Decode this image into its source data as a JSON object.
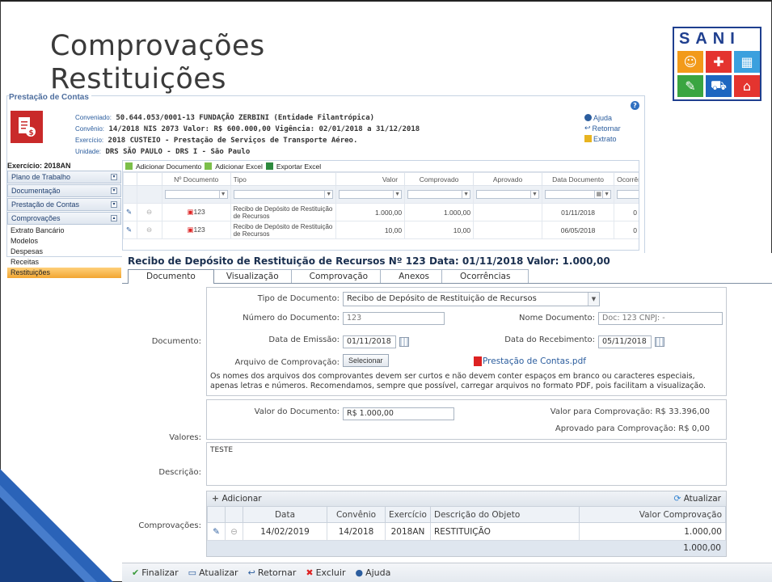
{
  "slide": {
    "title_line1": "Comprovações",
    "title_line2": "Restituições",
    "logo_text": "SANI"
  },
  "app": {
    "caption": "Prestação de Contas",
    "convenio_labels": {
      "conveniado": "Conveniado:",
      "convenio": "Convênio:",
      "exercicio": "Exercício:",
      "unidade": "Unidade:"
    },
    "conveniado": "50.644.053/0001-13 FUNDAÇÃO ZERBINI (Entidade Filantrópica)",
    "convenio": "14/2018 NIS 2073 Valor: R$ 600.000,00 Vigência: 02/01/2018 a 31/12/2018",
    "exercicio": "2018 CUSTEIO - Prestação de Serviços de Transporte Aéreo.",
    "unidade": "DRS SÃO PAULO - DRS I - São Paulo",
    "links": {
      "ajuda": "Ajuda",
      "retornar": "Retornar",
      "extrato": "Extrato"
    }
  },
  "sidebar": {
    "exercicio": "Exercício: 2018AN",
    "groups": [
      "Plano de Trabalho",
      "Documentação",
      "Prestação de Contas",
      "Comprovações"
    ],
    "items": [
      "Extrato Bancário",
      "Modelos",
      "Despesas",
      "Receitas",
      "Restituições"
    ]
  },
  "grid": {
    "toolbar": {
      "add_doc": "Adicionar Documento",
      "add_excel": "Adicionar Excel",
      "export_excel": "Exportar Excel"
    },
    "columns": [
      "Nº Documento",
      "Tipo",
      "Valor",
      "Comprovado",
      "Aprovado",
      "Data Documento",
      "Ocorrênci"
    ],
    "rows": [
      {
        "num": "123",
        "tipo": "Recibo de Depósito de Restituição de Recursos",
        "valor": "1.000,00",
        "comprovado": "1.000,00",
        "aprovado": "",
        "data": "01/11/2018",
        "ocorr": "0"
      },
      {
        "num": "123",
        "tipo": "Recibo de Depósito de Restituição de Recursos",
        "valor": "10,00",
        "comprovado": "10,00",
        "aprovado": "",
        "data": "06/05/2018",
        "ocorr": "0"
      }
    ]
  },
  "panel": {
    "title": "Recibo de Depósito de Restituição de Recursos Nº 123 Data: 01/11/2018 Valor: 1.000,00",
    "tabs": [
      "Documento",
      "Visualização",
      "Comprovação",
      "Anexos",
      "Ocorrências"
    ],
    "section_labels": {
      "documento": "Documento:",
      "valores": "Valores:",
      "descricao": "Descrição:",
      "comprovacoes": "Comprovações:"
    },
    "form": {
      "tipo_label": "Tipo de Documento:",
      "tipo_value": "Recibo de Depósito de Restituição de Recursos",
      "numero_label": "Número do Documento:",
      "numero_value": "123",
      "nome_label": "Nome Documento:",
      "nome_value": "Doc: 123 CNPJ: -",
      "emissao_label": "Data de Emissão:",
      "emissao_value": "01/11/2018",
      "recebimento_label": "Data do Recebimento:",
      "recebimento_value": "05/11/2018",
      "arquivo_label": "Arquivo de Comprovação:",
      "selecionar": "Selecionar",
      "pdf_name": "Prestação de Contas.pdf",
      "note": "Os nomes dos arquivos dos comprovantes devem ser curtos e não devem conter espaços em branco ou caracteres especiais, apenas letras e números. Recomendamos, sempre que possível, carregar arquivos no formato PDF, pois facilitam a visualização."
    },
    "valores": {
      "valor_doc_label": "Valor do Documento:",
      "valor_doc_value": "R$ 1.000,00",
      "valor_comprov": "Valor para Comprovação: R$ 33.396,00",
      "aprovado_comprov": "Aprovado para Comprovação: R$ 0,00"
    },
    "descricao": "TESTE",
    "comprovacoes": {
      "add": "Adicionar",
      "refresh": "Atualizar",
      "columns": [
        "",
        "",
        "Data",
        "Convênio",
        "Exercício",
        "Descrição do Objeto",
        "Valor Comprovação"
      ],
      "row": {
        "data": "14/02/2019",
        "convenio": "14/2018",
        "exercicio": "2018AN",
        "descricao": "RESTITUIÇÃO",
        "valor": "1.000,00"
      },
      "total": "1.000,00"
    },
    "actions": [
      "Finalizar",
      "Atualizar",
      "Retornar",
      "Excluir",
      "Ajuda"
    ]
  },
  "colors": {
    "accent": "#2b5d9e",
    "active_menu": "#f2a531",
    "pdf_red": "#d22222"
  }
}
